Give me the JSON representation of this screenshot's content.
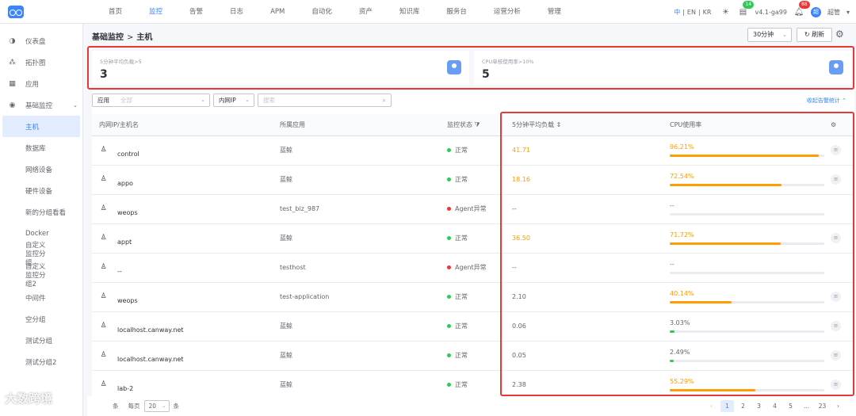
{
  "nav": {
    "items": [
      "首页",
      "监控",
      "告警",
      "日志",
      "APM",
      "自动化",
      "资产",
      "知识库",
      "服务台",
      "运营分析",
      "管理"
    ],
    "lang": [
      "中",
      "EN",
      "KR"
    ],
    "version": "v4.1-ga99",
    "badge_tasks": "14",
    "badge_notices": "88",
    "user": "超管",
    "avatar_text": "超"
  },
  "sidebar": {
    "items": [
      "仪表盘",
      "拓扑图",
      "应用",
      "基础监控"
    ],
    "subitems": [
      "主机",
      "数据库",
      "网络设备",
      "硬件设备",
      "新的分组看看",
      "Docker",
      "自定义监控分组",
      "自定义监控分组2",
      "中间件",
      "空分组",
      "测试分组",
      "测试分组2"
    ]
  },
  "header": {
    "breadcrumb_parent": "基础监控",
    "breadcrumb_current": "主机",
    "time_range": "30分钟",
    "refresh_label": "刷新"
  },
  "stats": [
    {
      "title": "5分钟平均负载>5",
      "value": "3"
    },
    {
      "title": "CPU单核使用率>10%",
      "value": "5"
    }
  ],
  "filter": {
    "app_label": "应用",
    "app_placeholder": "全部",
    "field_label": "内网IP",
    "search_placeholder": "搜索",
    "collapse_label": "收起告警统计"
  },
  "table": {
    "headers": [
      "内网IP/主机名",
      "所属应用",
      "监控状态",
      "5分钟平均负载",
      "CPU使用率"
    ],
    "rows": [
      {
        "host": "control",
        "app": "蓝鲸",
        "status": "正常",
        "load": "41.71",
        "cpu": "96.21%",
        "cpu_value": 96.21
      },
      {
        "host": "appo",
        "app": "蓝鲸",
        "status": "正常",
        "load": "18.16",
        "cpu": "72.54%",
        "cpu_value": 72.54
      },
      {
        "host": "weops",
        "app": "test_biz_987",
        "status": "Agent异常",
        "load": "--",
        "cpu": "--",
        "cpu_value": 0
      },
      {
        "host": "appt",
        "app": "蓝鲸",
        "status": "正常",
        "load": "36.50",
        "cpu": "71.72%",
        "cpu_value": 71.72
      },
      {
        "host": "--",
        "app": "testhost",
        "status": "Agent异常",
        "load": "--",
        "cpu": "--",
        "cpu_value": 0
      },
      {
        "host": "weops",
        "app": "test-application",
        "status": "正常",
        "load": "2.10",
        "cpu": "40.14%",
        "cpu_value": 40.14
      },
      {
        "host": "localhost.canway.net",
        "app": "蓝鲸",
        "status": "正常",
        "load": "0.06",
        "cpu": "3.03%",
        "cpu_value": 3.03
      },
      {
        "host": "localhost.canway.net",
        "app": "蓝鲸",
        "status": "正常",
        "load": "0.05",
        "cpu": "2.49%",
        "cpu_value": 2.49
      },
      {
        "host": "lab-2",
        "app": "蓝鲸",
        "status": "正常",
        "load": "2.38",
        "cpu": "55.29%",
        "cpu_value": 55.29
      }
    ]
  },
  "footer": {
    "total_suffix": "条",
    "per_page_label": "每页",
    "per_page": "20",
    "per_page_suffix": "条",
    "pages": [
      "1",
      "2",
      "3",
      "4",
      "5",
      "...",
      "23"
    ]
  },
  "colors": {
    "accent": "#3a84ff",
    "warn": "#ff9c01",
    "ok": "#2dcb56",
    "error": "#ea3636",
    "highlight_border": "#e53935"
  },
  "watermark": "大数跨境"
}
